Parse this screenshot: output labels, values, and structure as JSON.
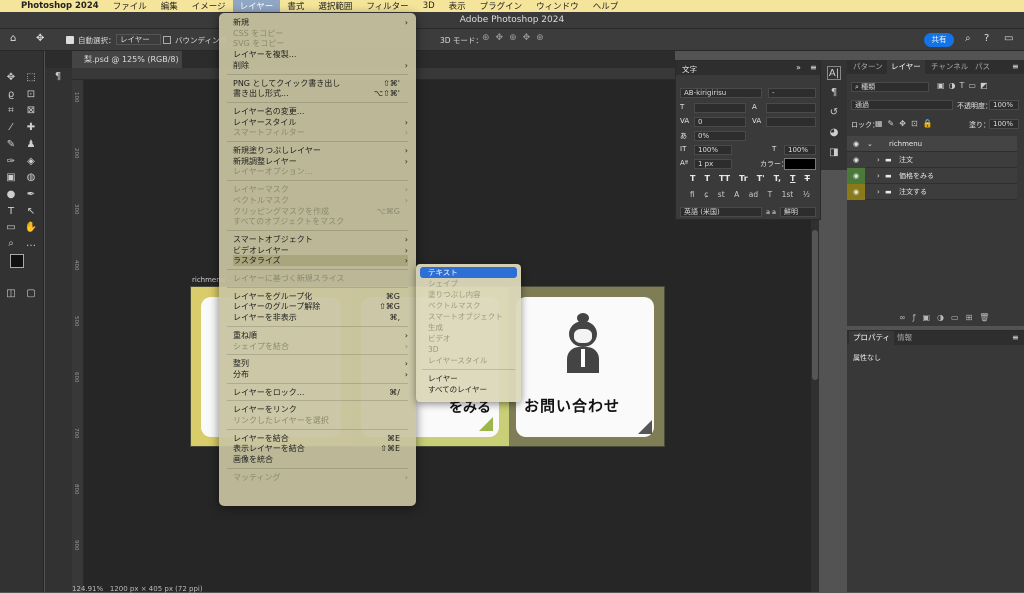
{
  "menubar": {
    "apple": "",
    "app": "Photoshop 2024",
    "items": [
      "ファイル",
      "編集",
      "イメージ",
      "レイヤー",
      "書式",
      "選択範囲",
      "フィルター",
      "3D",
      "表示",
      "プラグイン",
      "ウィンドウ",
      "ヘルプ"
    ]
  },
  "window": {
    "title": "Adobe Photoshop 2024"
  },
  "options": {
    "auto_select": "自動選択：",
    "layer_dropdown": "レイヤー",
    "bounding": "バウンディング",
    "mode3d": "3D モード：",
    "share": "共有"
  },
  "document": {
    "tab": "梨.psd @ 125% (RGB/8) *",
    "artboard_label": "richmenu",
    "card3_text": "お問い合わせ",
    "card2_text": "をみる",
    "zoom": "124.91%",
    "size_info": "1200 px × 405 px (72 ppi)"
  },
  "ruler_marks": [
    "100",
    "200",
    "300",
    "400",
    "500",
    "600",
    "700",
    "800",
    "900",
    "100",
    "200",
    "300",
    "400",
    "500",
    "600",
    "700",
    "800",
    "900"
  ],
  "layer_menu": [
    {
      "label": "新規",
      "arrow": true
    },
    {
      "label": "CSS をコピー",
      "dis": true
    },
    {
      "label": "SVG をコピー",
      "dis": true
    },
    {
      "label": "レイヤーを複製..."
    },
    {
      "label": "削除",
      "arrow": true
    },
    {
      "sep": true
    },
    {
      "label": "PNG としてクイック書き出し",
      "sc": "⇧⌘'"
    },
    {
      "label": "書き出し形式...",
      "sc": "⌥⇧⌘'"
    },
    {
      "sep": true
    },
    {
      "label": "レイヤー名の変更..."
    },
    {
      "label": "レイヤースタイル",
      "arrow": true
    },
    {
      "label": "スマートフィルター",
      "dis": true,
      "arrow": true
    },
    {
      "sep": true
    },
    {
      "label": "新規塗りつぶしレイヤー",
      "arrow": true
    },
    {
      "label": "新規調整レイヤー",
      "arrow": true
    },
    {
      "label": "レイヤーオプション...",
      "dis": true
    },
    {
      "sep": true
    },
    {
      "label": "レイヤーマスク",
      "dis": true,
      "arrow": true
    },
    {
      "label": "ベクトルマスク",
      "dis": true,
      "arrow": true
    },
    {
      "label": "クリッピングマスクを作成",
      "dis": true,
      "sc": "⌥⌘G"
    },
    {
      "label": "すべてのオブジェクトをマスク",
      "dis": true
    },
    {
      "sep": true
    },
    {
      "label": "スマートオブジェクト",
      "arrow": true
    },
    {
      "label": "ビデオレイヤー",
      "arrow": true
    },
    {
      "label": "ラスタライズ",
      "arrow": true,
      "active": true
    },
    {
      "sep": true
    },
    {
      "label": "レイヤーに基づく新規スライス",
      "dis": true
    },
    {
      "sep": true
    },
    {
      "label": "レイヤーをグループ化",
      "sc": "⌘G"
    },
    {
      "label": "レイヤーのグループ解除",
      "sc": "⇧⌘G"
    },
    {
      "label": "レイヤーを非表示",
      "sc": "⌘,"
    },
    {
      "sep": true
    },
    {
      "label": "重ね順",
      "arrow": true
    },
    {
      "label": "シェイプを結合",
      "dis": true,
      "arrow": true
    },
    {
      "sep": true
    },
    {
      "label": "整列",
      "arrow": true
    },
    {
      "label": "分布",
      "arrow": true
    },
    {
      "sep": true
    },
    {
      "label": "レイヤーをロック...",
      "sc": "⌘/"
    },
    {
      "sep": true
    },
    {
      "label": "レイヤーをリンク"
    },
    {
      "label": "リンクしたレイヤーを選択",
      "dis": true
    },
    {
      "sep": true
    },
    {
      "label": "レイヤーを結合",
      "sc": "⌘E"
    },
    {
      "label": "表示レイヤーを結合",
      "sc": "⇧⌘E"
    },
    {
      "label": "画像を統合"
    },
    {
      "sep": true
    },
    {
      "label": "マッティング",
      "dis": true,
      "arrow": true
    }
  ],
  "rasterize_menu": [
    {
      "label": "テキスト",
      "hl": true
    },
    {
      "label": "シェイプ",
      "dis": true
    },
    {
      "label": "塗りつぶし内容",
      "dis": true
    },
    {
      "label": "ベクトルマスク",
      "dis": true
    },
    {
      "label": "スマートオブジェクト",
      "dis": true
    },
    {
      "label": "生成",
      "dis": true
    },
    {
      "label": "ビデオ",
      "dis": true
    },
    {
      "label": "3D",
      "dis": true
    },
    {
      "label": "レイヤースタイル",
      "dis": true
    },
    {
      "sep": true
    },
    {
      "label": "レイヤー"
    },
    {
      "label": "すべてのレイヤー"
    }
  ],
  "character": {
    "tab": "文字",
    "font": "AB-kirigirisu",
    "style": "-",
    "kerning": "0",
    "tracking": "0%",
    "vscale": "100%",
    "hscale": "100%",
    "baseline": "1 px",
    "color_label": "カラー：",
    "language": "英語 (米国)",
    "aa_label": "a a",
    "aa": "鮮明",
    "glyph_row": [
      "T",
      "T",
      "TT",
      "Tr",
      "T'",
      "T,",
      "T",
      "T"
    ],
    "ot_row": [
      "fi",
      "ɕ",
      "st",
      "A",
      "ad",
      "T",
      "1st",
      "½"
    ]
  },
  "layers": {
    "tabs": [
      "パターン",
      "レイヤー",
      "チャンネル",
      "パス"
    ],
    "kind": "種類",
    "blend": "通過",
    "opacity_label": "不透明度：",
    "opacity": "100%",
    "lock_label": "ロック：",
    "fill_label": "塗り：",
    "fill": "100%",
    "rows": [
      {
        "name": "richmenu",
        "group": true
      },
      {
        "name": "注文",
        "color": "#3d3d3d"
      },
      {
        "name": "価格をみる",
        "color": "#4a7a3a"
      },
      {
        "name": "注文する",
        "color": "#8a7a1a"
      }
    ]
  },
  "properties": {
    "tabs": [
      "プロパティ",
      "情報"
    ],
    "text": "属性なし"
  }
}
